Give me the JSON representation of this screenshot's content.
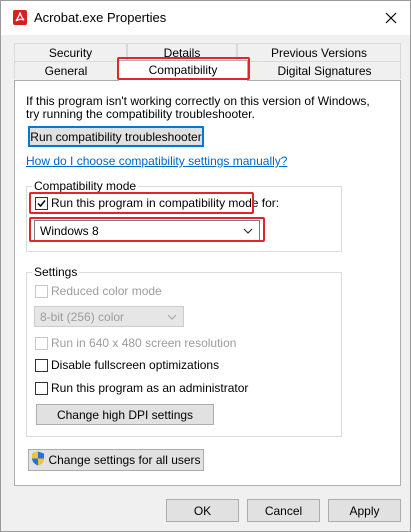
{
  "window": {
    "title": "Acrobat.exe Properties",
    "icon": "acrobat-icon",
    "close_icon": "close-icon"
  },
  "tabs": {
    "row1": [
      "Security",
      "Details",
      "Previous Versions"
    ],
    "row2": [
      "General",
      "Compatibility",
      "Digital Signatures"
    ],
    "active": "Compatibility"
  },
  "intro": {
    "line1": "If this program isn't working correctly on this version of Windows,",
    "line2": "try running the compatibility troubleshooter."
  },
  "troubleshooter_button": "Run compatibility troubleshooter",
  "manual_link": "How do I choose compatibility settings manually?",
  "compat_mode": {
    "group_label": "Compatibility mode",
    "checkbox_label": "Run this program in compatibility mode for:",
    "checked": true,
    "selected_os": "Windows 8"
  },
  "settings": {
    "group_label": "Settings",
    "reduced_color": {
      "label": "Reduced color mode",
      "checked": false,
      "disabled": true
    },
    "color_depth": {
      "value": "8-bit (256) color",
      "disabled": true
    },
    "resolution": {
      "label": "Run in 640 x 480 screen resolution",
      "checked": false,
      "disabled": true
    },
    "fullscreen_opt": {
      "label": "Disable fullscreen optimizations",
      "checked": false
    },
    "admin": {
      "label": "Run this program as an administrator",
      "checked": false
    },
    "dpi_button": "Change high DPI settings"
  },
  "all_users_button": "Change settings for all users",
  "footer": {
    "ok": "OK",
    "cancel": "Cancel",
    "apply": "Apply"
  },
  "colors": {
    "highlight": "#e0262c",
    "link": "#0066cc",
    "accent": "#0078d7"
  }
}
